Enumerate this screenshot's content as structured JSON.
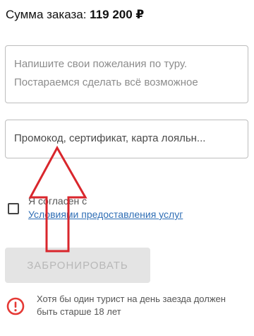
{
  "order": {
    "label": "Сумма заказа:",
    "amount": "119 200 ₽"
  },
  "wishes_field": {
    "placeholder_line1": "Напишите свои пожелания по туру.",
    "placeholder_line2": "Постараемся сделать всё возможное"
  },
  "promo_field": {
    "placeholder": "Промокод, сертификат, карта лояльн..."
  },
  "agreement": {
    "checked": false,
    "text": "Я согласен с",
    "link": "Условиями предоставления услуг"
  },
  "book_button": {
    "label": "ЗАБРОНИРОВАТЬ",
    "enabled": false
  },
  "notice": {
    "icon": "exclamation-circle-icon",
    "text": "Хотя бы один турист на день заезда должен быть старше 18 лет",
    "icon_color": "#e53935"
  },
  "annotation": {
    "type": "arrow-pointing-up",
    "color": "#d9262c"
  }
}
